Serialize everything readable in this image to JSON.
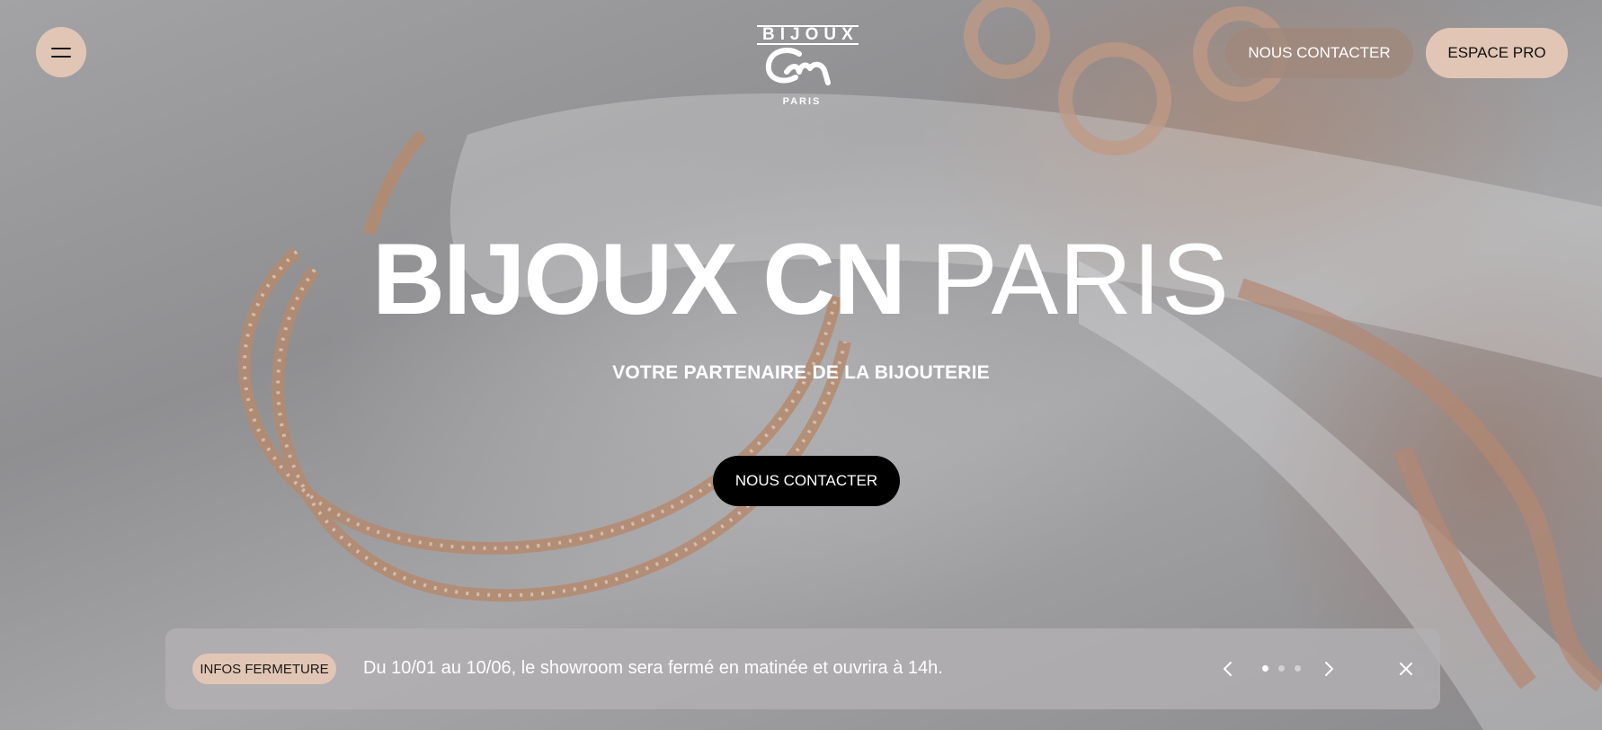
{
  "header": {
    "menu_icon": "hamburger-menu-icon",
    "logo": {
      "top": "BIJOUX",
      "bottom": "PARIS"
    },
    "contact_label": "NOUS CONTACTER",
    "espace_label": "ESPACE PRO"
  },
  "hero": {
    "title_bold": "BIJOUX CN",
    "title_light": "PARIS",
    "subtitle": "VOTRE PARTENAIRE DE LA BIJOUTERIE",
    "cta_label": "NOUS CONTACTER"
  },
  "banner": {
    "badge": "INFOS FERMETURE",
    "message": "Du 10/01 au 10/06, le showroom sera fermé en matinée et ouvrira à 14h.",
    "slides_total": 3,
    "slide_active": 1,
    "icons": {
      "prev": "chevron-left-icon",
      "next": "chevron-right-icon",
      "close": "close-icon"
    }
  },
  "colors": {
    "accent": "#e2c6b5",
    "contact_top_bg": "#a0887c",
    "cta_bg": "#000000",
    "text_light": "#ffffff"
  }
}
